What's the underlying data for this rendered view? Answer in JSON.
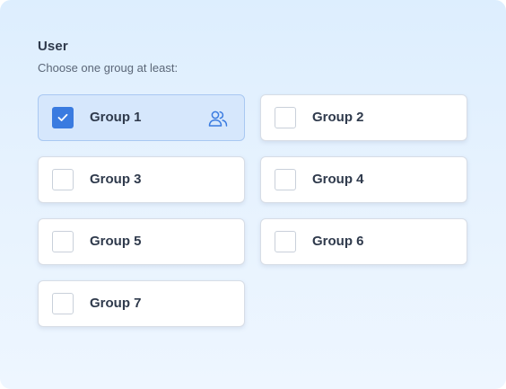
{
  "header": {
    "title": "User",
    "subtitle": "Choose one groug at least:"
  },
  "groups": [
    {
      "label": "Group 1",
      "checked": true,
      "icon": "users-icon"
    },
    {
      "label": "Group 2",
      "checked": false
    },
    {
      "label": "Group 3",
      "checked": false
    },
    {
      "label": "Group 4",
      "checked": false
    },
    {
      "label": "Group 5",
      "checked": false
    },
    {
      "label": "Group 6",
      "checked": false
    },
    {
      "label": "Group 7",
      "checked": false
    }
  ],
  "colors": {
    "accent": "#3a7be0",
    "selected_bg": "#d6e7fc",
    "text": "#2f3a4c"
  }
}
